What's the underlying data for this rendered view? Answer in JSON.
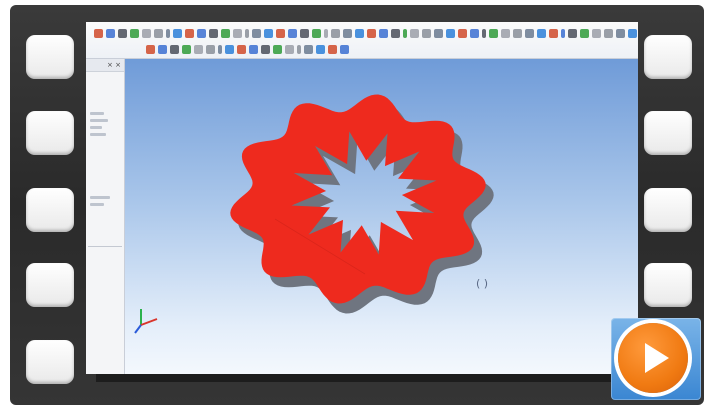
{
  "video": {
    "play_label": "Play video"
  },
  "viewport": {
    "dimension_label": "( )",
    "shape_color": "#ee2a1e",
    "shape_shadow_color": "#6f7580",
    "background_top": "#6f9bd8",
    "background_bottom": "#f4f8fd"
  },
  "left_panel": {
    "header_text": "× ×"
  },
  "colors": {
    "play_orange": "#f07a12",
    "play_panel_blue": "#3a86d2",
    "film_dark": "#2f2f2f"
  },
  "icons": {
    "toolbar": "toolbar-icons",
    "triad": "axis-triad-icon",
    "play": "play-icon"
  }
}
